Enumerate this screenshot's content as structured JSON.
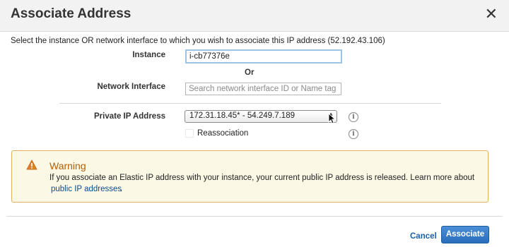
{
  "dialog": {
    "title": "Associate Address",
    "close_symbol": "✕",
    "intro": "Select the instance OR network interface to which you wish to associate this IP address (52.192.43.106)"
  },
  "form": {
    "instance_label": "Instance",
    "instance_value": "i-cb77376e",
    "or_label": "Or",
    "network_interface_label": "Network Interface",
    "network_interface_placeholder": "Search network interface ID or Name tag",
    "private_ip_label": "Private IP Address",
    "private_ip_selected": "172.31.18.45* - 54.249.7.189",
    "reassociation_label": "Reassociation",
    "reassociation_checked": false,
    "info_symbol": "i"
  },
  "warning": {
    "title": "Warning",
    "text": "If you associate an Elastic IP address with your instance, your current public IP address is released. Learn more about",
    "link": "public IP addresses",
    "link_suffix": ".",
    "icon": "warning-triangle-icon",
    "accent_color": "#b45f06"
  },
  "footer": {
    "cancel_label": "Cancel",
    "associate_label": "Associate",
    "primary_color": "#2a6dbb"
  }
}
